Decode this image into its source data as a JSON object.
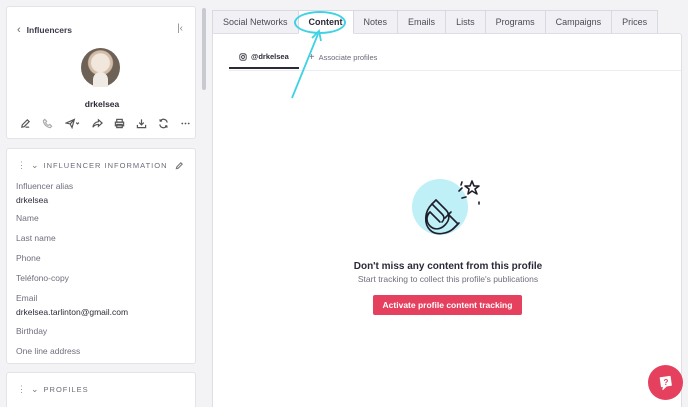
{
  "sidebar": {
    "back_label": "Influencers",
    "handle": "drkelsea",
    "actions": [
      "edit-icon",
      "phone-icon",
      "send-icon",
      "share-icon",
      "print-icon",
      "download-icon",
      "refresh-icon",
      "more-icon"
    ],
    "info_section": {
      "title": "INFLUENCER INFORMATION",
      "fields": [
        {
          "label": "Influencer alias",
          "value": "drkelsea"
        },
        {
          "label": "Name",
          "value": ""
        },
        {
          "label": "Last name",
          "value": ""
        },
        {
          "label": "Phone",
          "value": ""
        },
        {
          "label": "Teléfono-copy",
          "value": ""
        },
        {
          "label": "Email",
          "value": "drkelsea.tarlinton@gmail.com"
        },
        {
          "label": "Birthday",
          "value": ""
        },
        {
          "label": "One line address",
          "value": ""
        }
      ]
    },
    "profiles_section": {
      "title": "PROFILES"
    }
  },
  "tabs": [
    "Social Networks",
    "Content",
    "Notes",
    "Emails",
    "Lists",
    "Programs",
    "Campaigns",
    "Prices"
  ],
  "active_tab": "Content",
  "subtabs": {
    "profile": "@drkelsea",
    "associate": "Associate profiles"
  },
  "empty_state": {
    "title": "Don't miss any content from this profile",
    "subtitle": "Start tracking to collect this profile's publications",
    "button": "Activate profile content tracking"
  },
  "colors": {
    "accent": "#e5405e",
    "highlight": "#3fd2e6",
    "illustration_bg": "#bfeff7"
  }
}
